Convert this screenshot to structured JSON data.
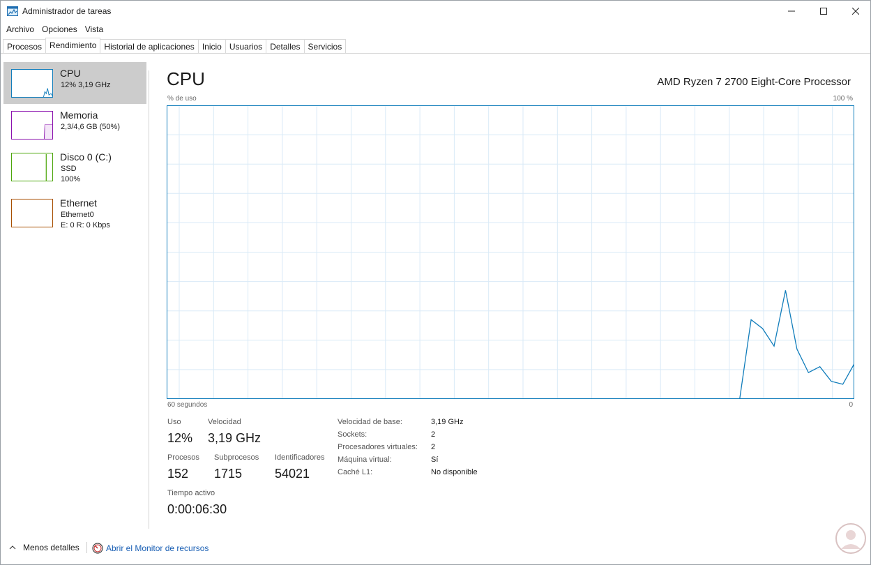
{
  "window": {
    "title": "Administrador de tareas",
    "icon": "task-manager-icon"
  },
  "menu": [
    "Archivo",
    "Opciones",
    "Vista"
  ],
  "tabs": [
    {
      "label": "Procesos",
      "active": false
    },
    {
      "label": "Rendimiento",
      "active": true
    },
    {
      "label": "Historial de aplicaciones",
      "active": false
    },
    {
      "label": "Inicio",
      "active": false
    },
    {
      "label": "Usuarios",
      "active": false
    },
    {
      "label": "Detalles",
      "active": false
    },
    {
      "label": "Servicios",
      "active": false
    }
  ],
  "sidebar": {
    "items": [
      {
        "title": "CPU",
        "lines": [
          "12%  3,19 GHz"
        ],
        "color": "#117dbb",
        "active": true
      },
      {
        "title": "Memoria",
        "lines": [
          "2,3/4,6 GB (50%)"
        ],
        "color": "#8b12ae",
        "active": false
      },
      {
        "title": "Disco 0 (C:)",
        "lines": [
          "SSD",
          "100%"
        ],
        "color": "#4da60c",
        "active": false
      },
      {
        "title": "Ethernet",
        "lines": [
          "Ethernet0",
          "E: 0  R: 0 Kbps"
        ],
        "color": "#a74f01",
        "active": false
      }
    ]
  },
  "main": {
    "title": "CPU",
    "processor": "AMD Ryzen 7 2700 Eight-Core Processor",
    "axis": {
      "top_left": "% de uso",
      "top_right": "100 %",
      "bottom_left": "60 segundos",
      "bottom_right": "0"
    },
    "stats": {
      "uso_label": "Uso",
      "uso_value": "12%",
      "velocidad_label": "Velocidad",
      "velocidad_value": "3,19 GHz",
      "procesos_label": "Procesos",
      "procesos_value": "152",
      "subprocesos_label": "Subprocesos",
      "subprocesos_value": "1715",
      "identificadores_label": "Identificadores",
      "identificadores_value": "54021",
      "tiempo_label": "Tiempo activo",
      "tiempo_value": "0:00:06:30"
    },
    "info": [
      {
        "label": "Velocidad de base:",
        "value": "3,19 GHz"
      },
      {
        "label": "Sockets:",
        "value": "2"
      },
      {
        "label": "Procesadores virtuales:",
        "value": "2"
      },
      {
        "label": "Máquina virtual:",
        "value": "Sí"
      },
      {
        "label": "Caché L1:",
        "value": "No disponible"
      }
    ]
  },
  "footer": {
    "fewer_details": "Menos detalles",
    "resource_monitor": "Abrir el Monitor de recursos"
  },
  "chart_data": {
    "type": "line",
    "xlabel": "60 segundos",
    "ylabel": "% de uso",
    "xlim": [
      60,
      0
    ],
    "ylim": [
      0,
      100
    ],
    "color": "#117dbb",
    "series": [
      {
        "x": [
          10,
          9,
          8,
          7,
          6,
          5,
          4,
          3,
          2,
          1,
          0
        ],
        "values": [
          0,
          27,
          24,
          18,
          37,
          17,
          9,
          11,
          6,
          5,
          12
        ]
      }
    ]
  }
}
